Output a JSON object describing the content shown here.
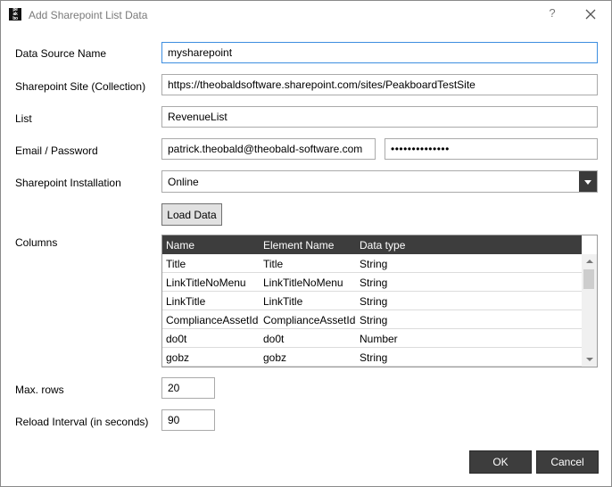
{
  "window": {
    "title": "Add Sharepoint List Data",
    "app_icon_text": "peak board",
    "help_label": "?"
  },
  "form": {
    "data_source_name": {
      "label": "Data Source Name",
      "value": "mysharepoint"
    },
    "sharepoint_site": {
      "label": "Sharepoint Site (Collection)",
      "value": "https://theobaldsoftware.sharepoint.com/sites/PeakboardTestSite"
    },
    "list": {
      "label": "List",
      "value": "RevenueList"
    },
    "credentials": {
      "label": "Email / Password",
      "email": "patrick.theobald@theobald-software.com",
      "password": "••••••••••••••"
    },
    "installation": {
      "label": "Sharepoint Installation",
      "value": "Online"
    },
    "load_button": "Load Data",
    "columns_label": "Columns",
    "max_rows": {
      "label": "Max. rows",
      "value": "20"
    },
    "reload_interval": {
      "label": "Reload Interval (in seconds)",
      "value": "90"
    }
  },
  "columns_grid": {
    "headers": [
      "Name",
      "Element Name",
      "Data type"
    ],
    "rows": [
      [
        "Title",
        "Title",
        "String"
      ],
      [
        "LinkTitleNoMenu",
        "LinkTitleNoMenu",
        "String"
      ],
      [
        "LinkTitle",
        "LinkTitle",
        "String"
      ],
      [
        "ComplianceAssetId",
        "ComplianceAssetId",
        "String"
      ],
      [
        "do0t",
        "do0t",
        "Number"
      ],
      [
        "gobz",
        "gobz",
        "String"
      ]
    ]
  },
  "buttons": {
    "ok": "OK",
    "cancel": "Cancel"
  }
}
